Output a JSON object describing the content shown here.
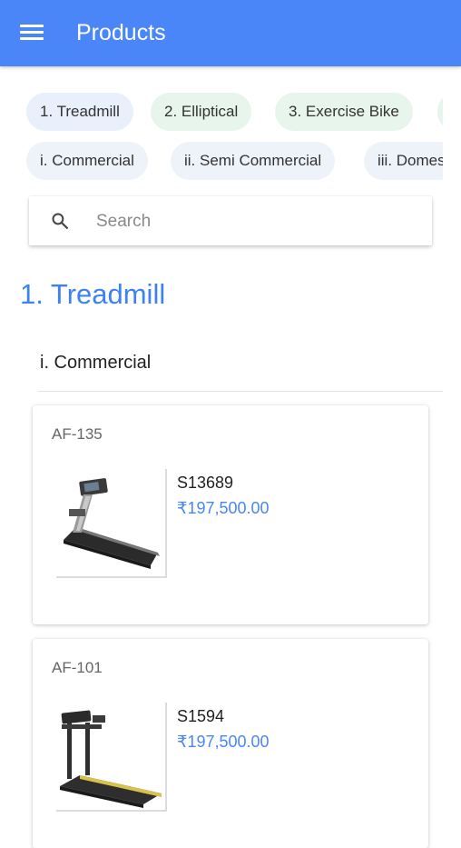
{
  "header": {
    "title": "Products",
    "menu_icon": "menu-icon"
  },
  "categories": [
    {
      "label": "1. Treadmill",
      "color": "#e8f0fe"
    },
    {
      "label": "2. Elliptical",
      "color": "#e6f4ea"
    },
    {
      "label": "3. Exercise Bike",
      "color": "#e6f4ea"
    }
  ],
  "subcategories": [
    {
      "label": "i. Commercial"
    },
    {
      "label": "ii. Semi Commercial"
    },
    {
      "label": "iii. Domestic"
    }
  ],
  "search": {
    "placeholder": "Search",
    "icon": "search-icon"
  },
  "section": {
    "title": "1. Treadmill",
    "subtitle": "i. Commercial"
  },
  "products": [
    {
      "code": "AF-135",
      "sku": "S13689",
      "price": "₹197,500.00"
    },
    {
      "code": "AF-101",
      "sku": "S1594",
      "price": "₹197,500.00"
    }
  ],
  "colors": {
    "primary": "#4a86f7",
    "section_title": "#3e82f0",
    "price": "#4a86f7"
  }
}
